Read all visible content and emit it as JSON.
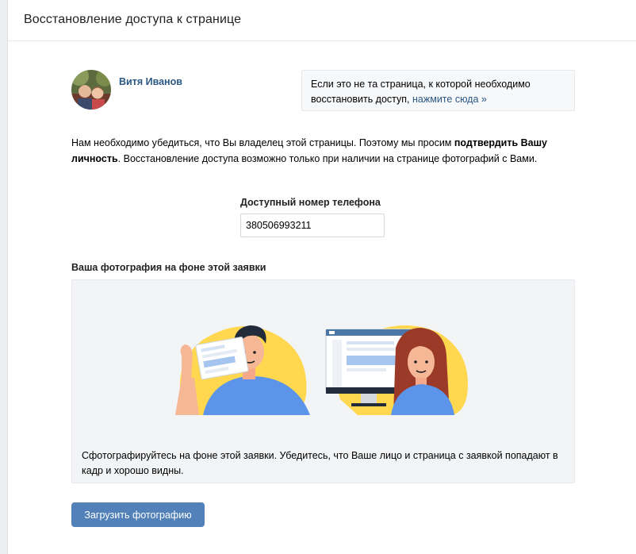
{
  "header": {
    "title": "Восстановление доступа к странице"
  },
  "profile": {
    "name": "Витя Иванов"
  },
  "notice": {
    "text": "Если это не та страница, к которой необходимо восстановить доступ,",
    "link": "нажмите сюда »"
  },
  "intro": {
    "part1": "Нам необходимо убедиться, что Вы владелец этой страницы. Поэтому мы просим ",
    "bold": "подтвердить Вашу личность",
    "part2": ". Восстановление доступа возможно только при наличии на странице фотографий с Вами."
  },
  "phone": {
    "label": "Доступный номер телефона",
    "value": "380506993211"
  },
  "photo": {
    "label": "Ваша фотография на фоне этой заявки",
    "hint": "Сфотографируйтесь на фоне этой заявки. Убедитесь, что Ваше лицо и страница с заявкой попадают в кадр и хорошо видны."
  },
  "upload_button": "Загрузить фотографию",
  "colors": {
    "accent": "#5181b8",
    "link": "#2a5885",
    "illustration_yellow": "#ffd84f",
    "illustration_blue": "#5b94e8"
  }
}
